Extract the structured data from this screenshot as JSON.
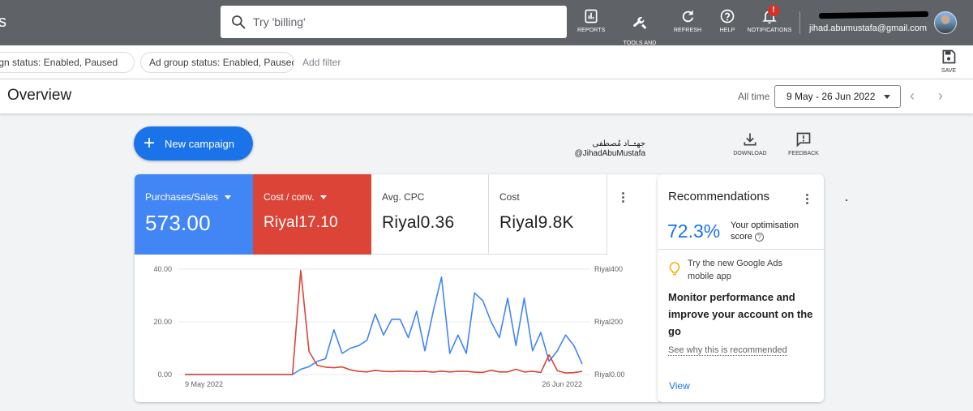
{
  "topbar": {
    "partial_letter": "s",
    "search_placeholder": "Try 'billing'",
    "tools": [
      {
        "label": "REPORTS"
      },
      {
        "label": "TOOLS AND\nSETTINGS"
      },
      {
        "label": "REFRESH"
      },
      {
        "label": "HELP"
      },
      {
        "label": "NOTIFICATIONS",
        "badge": "!"
      }
    ],
    "account_email": "jihad.abumustafa@gmail.com"
  },
  "filters": {
    "chips": [
      "Campaign status: Enabled, Paused",
      "Ad group status: Enabled, Paused"
    ],
    "add_filter": "Add filter",
    "save_label": "SAVE"
  },
  "header": {
    "title": "Overview",
    "range_label": "All time",
    "date_range": "9 May - 26 Jun 2022"
  },
  "actions": {
    "new_campaign": "New campaign",
    "download": "DOWNLOAD",
    "feedback": "FEEDBACK"
  },
  "watermark": {
    "arabic_name": "جهـــاد مُصطفى",
    "handle": "@JihadAbuMustafa"
  },
  "metrics": [
    {
      "label": "Purchases/Sales",
      "value": "573.00",
      "color": "#4285f4"
    },
    {
      "label": "Cost / conv.",
      "value": "Riyal17.10",
      "color": "#db4437"
    },
    {
      "label": "Avg. CPC",
      "value": "Riyal0.36"
    },
    {
      "label": "Cost",
      "value": "Riyal9.8K"
    }
  ],
  "chart_data": {
    "type": "line",
    "x_start": "9 May 2022",
    "x_end": "26 Jun 2022",
    "left_ticks": [
      "40.00",
      "20.00",
      "0.00"
    ],
    "right_ticks": [
      "Riyal400",
      "Riyal200",
      "Riyal0.00"
    ],
    "left_ylim": [
      0,
      40
    ],
    "right_ylim": [
      0,
      400
    ],
    "grid": true,
    "series": [
      {
        "name": "Purchases/Sales",
        "axis": "left",
        "color": "#4285f4",
        "values": [
          0,
          0,
          0,
          0,
          0,
          0,
          0,
          0,
          0,
          0,
          0,
          0,
          0,
          0,
          2,
          3,
          5,
          6,
          17,
          8,
          10,
          11,
          13,
          23,
          15,
          21,
          21,
          14,
          24,
          9,
          24,
          37,
          8,
          15,
          8,
          31,
          28,
          20,
          14,
          29,
          11,
          29,
          9,
          16,
          5,
          9,
          15,
          11,
          4
        ]
      },
      {
        "name": "Cost / conv.",
        "axis": "right",
        "color": "#db4437",
        "values": [
          0,
          0,
          0,
          0,
          0,
          0,
          0,
          0,
          0,
          0,
          0,
          0,
          0,
          0,
          395,
          88,
          35,
          28,
          26,
          29,
          18,
          12,
          10,
          16,
          12,
          11,
          13,
          12,
          11,
          12,
          9,
          13,
          10,
          12,
          12,
          9,
          8,
          16,
          10,
          10,
          20,
          10,
          12,
          8,
          75,
          14,
          6,
          7,
          12
        ]
      }
    ]
  },
  "recommendations": {
    "title": "Recommendations",
    "score": "72.3%",
    "score_label": "Your optimisation score",
    "tip": "Try the new Google Ads mobile app",
    "headline": "Monitor performance and improve your account on the go",
    "link": "See why this is recommended",
    "view": "View"
  }
}
